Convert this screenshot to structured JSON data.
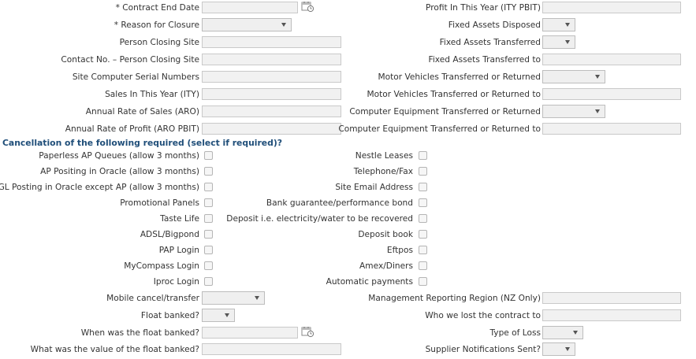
{
  "form_left": {
    "contract_end_date": {
      "label": "* Contract End Date",
      "value": ""
    },
    "reason_for_closure": {
      "label": "* Reason for Closure",
      "value": ""
    },
    "person_closing_site": {
      "label": "Person Closing Site",
      "value": ""
    },
    "contact_no_person_closing_site": {
      "label": "Contact No. – Person Closing Site",
      "value": ""
    },
    "site_computer_serial_numbers": {
      "label": "Site Computer Serial Numbers",
      "value": ""
    },
    "sales_this_year": {
      "label": "Sales In This Year (ITY)",
      "value": ""
    },
    "annual_rate_of_sales": {
      "label": "Annual Rate of Sales (ARO)",
      "value": ""
    },
    "annual_rate_of_profit": {
      "label": "Annual Rate of Profit (ARO PBIT)",
      "value": ""
    }
  },
  "form_right": {
    "profit_this_year": {
      "label": "Profit In This Year (ITY PBIT)",
      "value": ""
    },
    "fixed_assets_disposed": {
      "label": "Fixed Assets Disposed",
      "value": ""
    },
    "fixed_assets_transferred": {
      "label": "Fixed Assets Transferred",
      "value": ""
    },
    "fixed_assets_transferred_to": {
      "label": "Fixed Assets Transferred to",
      "value": ""
    },
    "motor_vehicles_transferred": {
      "label": "Motor Vehicles Transferred or Returned",
      "value": ""
    },
    "motor_vehicles_transferred_to": {
      "label": "Motor Vehicles Transferred or Returned to",
      "value": ""
    },
    "computer_equipment_transferred": {
      "label": "Computer Equipment Transferred or Returned",
      "value": ""
    },
    "computer_equipment_transferred_to": {
      "label": "Computer Equipment Transferred or Returned to",
      "value": ""
    }
  },
  "cancellation": {
    "heading": "Cancellation of the following required (select if required)?",
    "left_items": [
      {
        "label": "Paperless AP Queues (allow 3 months)",
        "checked": false
      },
      {
        "label": "AP Positing in Oracle (allow 3 months)",
        "checked": false
      },
      {
        "label": "GL Posting in Oracle except AP (allow 3 months)",
        "checked": false
      },
      {
        "label": "Promotional Panels",
        "checked": false
      },
      {
        "label": "Taste Life",
        "checked": false
      },
      {
        "label": "ADSL/Bigpond",
        "checked": false
      },
      {
        "label": "PAP Login",
        "checked": false
      },
      {
        "label": "MyCompass Login",
        "checked": false
      },
      {
        "label": "Iproc Login",
        "checked": false
      }
    ],
    "right_items": [
      {
        "label": "Nestle Leases",
        "checked": false
      },
      {
        "label": "Telephone/Fax",
        "checked": false
      },
      {
        "label": "Site Email Address",
        "checked": false
      },
      {
        "label": "Bank guarantee/performance bond",
        "checked": false
      },
      {
        "label": "Deposit i.e. electricity/water to be recovered",
        "checked": false
      },
      {
        "label": "Deposit book",
        "checked": false
      },
      {
        "label": "Eftpos",
        "checked": false
      },
      {
        "label": "Amex/Diners",
        "checked": false
      },
      {
        "label": "Automatic payments",
        "checked": false
      }
    ]
  },
  "bottom_left": {
    "mobile_cancel_transfer": {
      "label": "Mobile cancel/transfer",
      "value": ""
    },
    "float_banked": {
      "label": "Float banked?",
      "value": ""
    },
    "when_float_banked": {
      "label": "When was the float banked?",
      "value": ""
    },
    "value_float_banked": {
      "label": "What was the value of the float banked?",
      "value": ""
    }
  },
  "bottom_right": {
    "management_reporting_region": {
      "label": "Management Reporting Region (NZ Only)",
      "value": ""
    },
    "who_lost_contract_to": {
      "label": "Who we lost the contract to",
      "value": ""
    },
    "type_of_loss": {
      "label": "Type of Loss",
      "value": ""
    },
    "supplier_notifications_sent": {
      "label": "Supplier Notifications Sent?",
      "value": ""
    }
  },
  "icons": {
    "calendar": "calendar-icon",
    "dropdown": "chevron-down-icon"
  },
  "colors": {
    "heading": "#1f4e79",
    "field_bg": "#f1f1f1",
    "field_border": "#c9c9c9"
  }
}
